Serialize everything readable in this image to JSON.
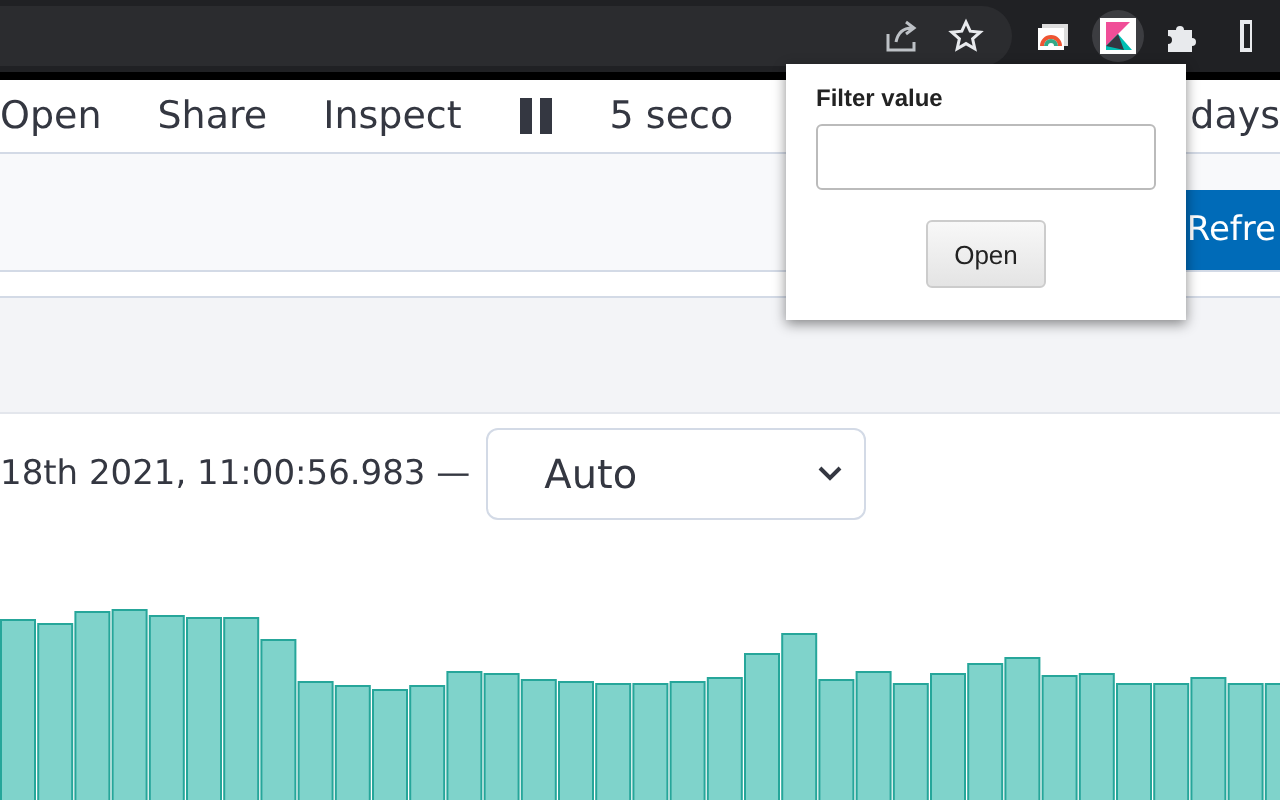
{
  "browser_toolbar": {
    "extensions": [
      {
        "kind": "palette",
        "selected": false
      },
      {
        "kind": "app",
        "selected": true
      },
      {
        "kind": "puzzle",
        "selected": false
      },
      {
        "kind": "edge",
        "selected": false
      }
    ]
  },
  "nav": {
    "items": [
      "Open",
      "Share",
      "Inspect"
    ],
    "refresh_interval": "5 seco",
    "time_range": "days"
  },
  "query_bar": {
    "button": "Refre"
  },
  "time_header": {
    "range_text": "18th 2021, 11:00:56.983 —",
    "interval": "Auto"
  },
  "popup": {
    "label": "Filter value",
    "button": "Open"
  }
}
